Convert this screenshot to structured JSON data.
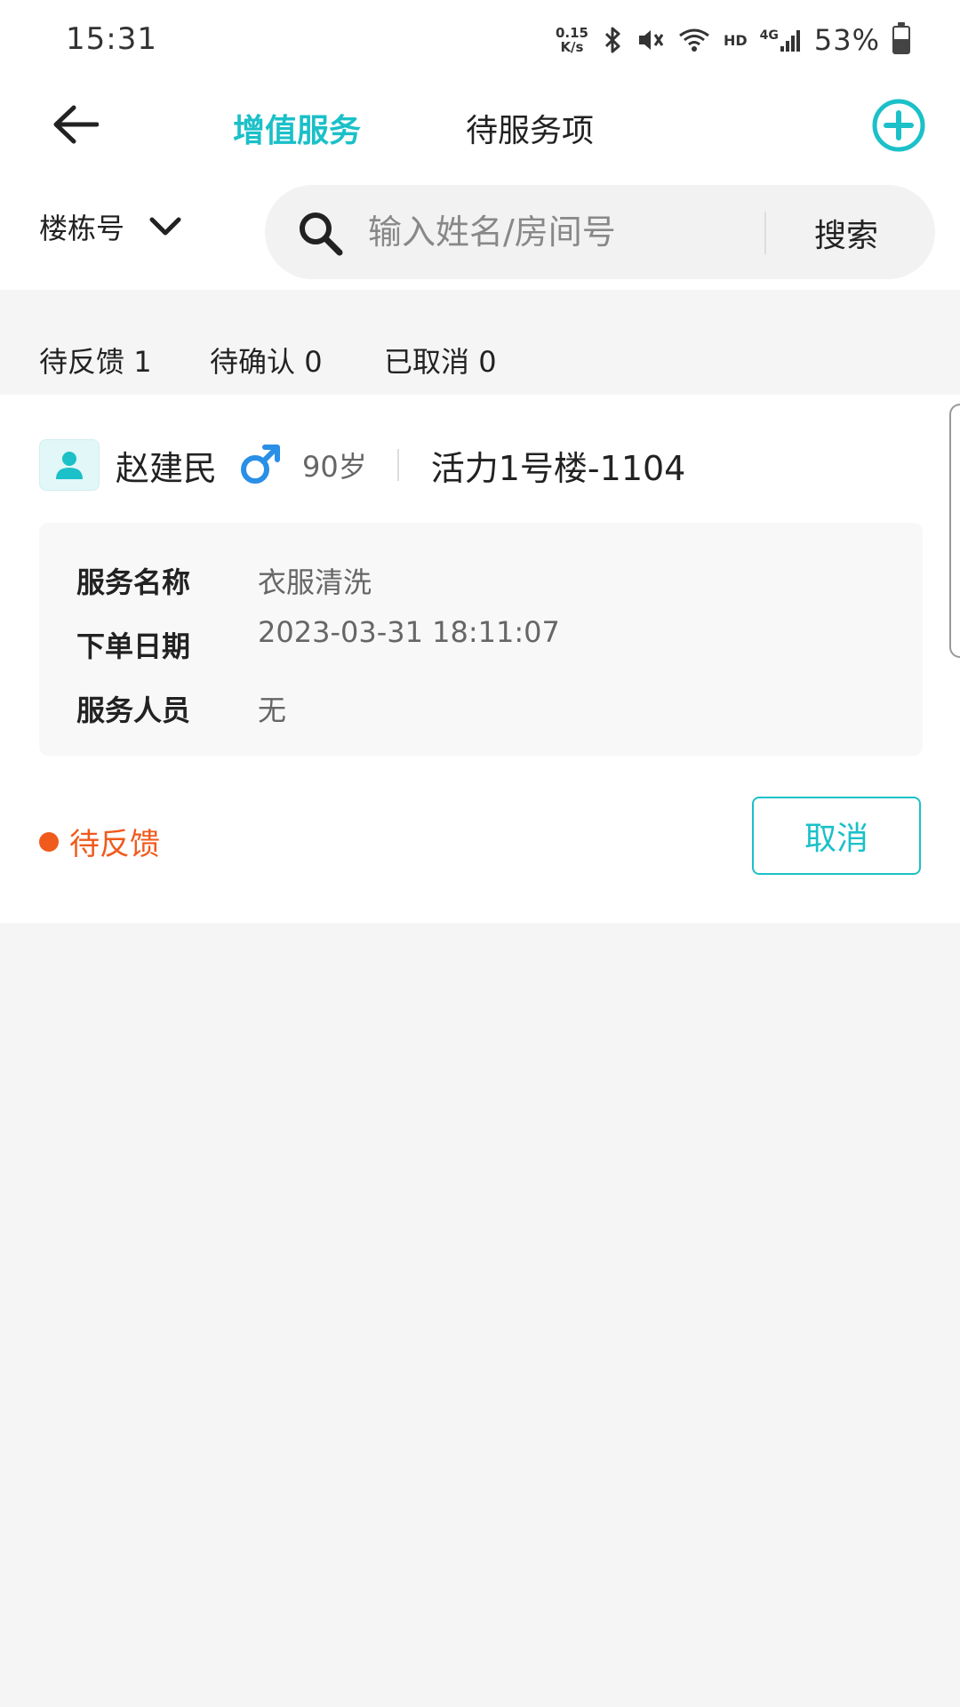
{
  "status_bar": {
    "time": "15:31",
    "net_speed_value": "0.15",
    "net_speed_unit": "K/s",
    "hd": "HD",
    "signal_type": "4G",
    "battery": "53%",
    "battery_level": 0.53,
    "icons": [
      "bluetooth-icon",
      "mute-icon",
      "wifi-icon",
      "signal-icon",
      "battery-icon"
    ]
  },
  "nav": {
    "tabs": [
      {
        "label": "增值服务",
        "active": true
      },
      {
        "label": "待服务项",
        "active": false
      }
    ],
    "accent_color": "#1bc0c8"
  },
  "filter": {
    "building_label": "楼栋号",
    "search_placeholder": "输入姓名/房间号",
    "search_value": "",
    "search_button": "搜索"
  },
  "counts": [
    {
      "label": "待反馈",
      "value": "1"
    },
    {
      "label": "待确认",
      "value": "0"
    },
    {
      "label": "已取消",
      "value": "0"
    }
  ],
  "orders": [
    {
      "name": "赵建民",
      "gender": "male",
      "age": "90岁",
      "room": "活力1号楼-1104",
      "fields": [
        {
          "label": "服务名称",
          "value": "衣服清洗"
        },
        {
          "label": "下单日期",
          "value": "2023-03-31 18:11:07"
        },
        {
          "label": "服务人员",
          "value": "无"
        }
      ],
      "status": "待反馈",
      "status_color": "#f05a1c",
      "action": "取消"
    }
  ]
}
